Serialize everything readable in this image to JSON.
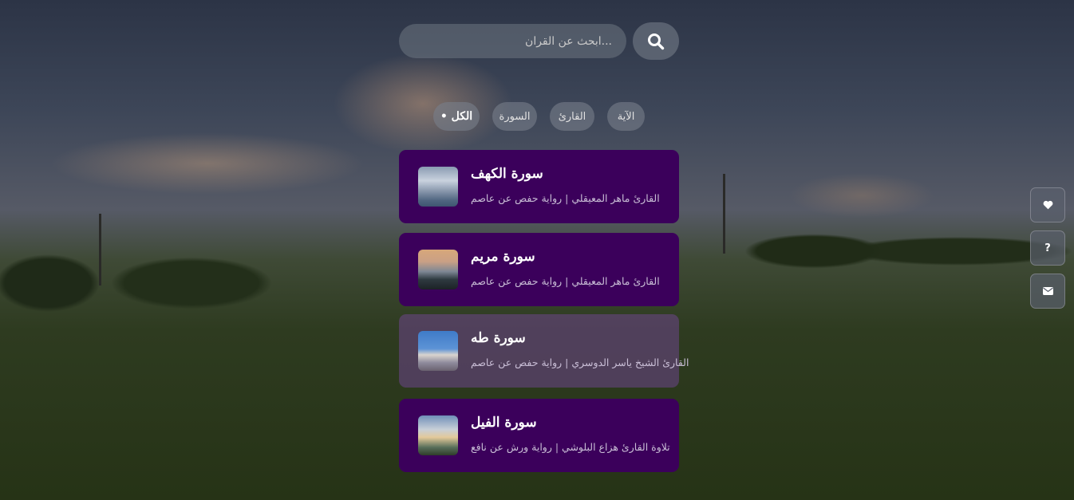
{
  "search": {
    "placeholder": "...ابحث عن القران"
  },
  "filters": [
    {
      "label": "الآية",
      "active": false
    },
    {
      "label": "القارئ",
      "active": false
    },
    {
      "label": "السورة",
      "active": false
    },
    {
      "label": "الكل •",
      "active": true
    }
  ],
  "results": [
    {
      "title": "سورة الكهف",
      "subtitle": "القارئ ماهر المعيقلي | رواية حفص عن عاصم",
      "thumbnail": "cloudy-sky"
    },
    {
      "title": "سورة مريم",
      "subtitle": "القارئ ماهر المعيقلي | رواية حفص عن عاصم",
      "thumbnail": "sea-rocks"
    },
    {
      "title": "سورة طه",
      "subtitle": "القارئ الشيخ ياسر الدوسري | رواية حفص عن عاصم",
      "thumbnail": "lighthouse-flowers"
    },
    {
      "title": "سورة الفيل",
      "subtitle": "تلاوة القارئ هزاع البلوشي | رواية ورش عن نافع",
      "thumbnail": "sunset-clouds"
    }
  ],
  "side_buttons": [
    {
      "icon": "heart-icon"
    },
    {
      "icon": "question-icon",
      "label": "?"
    },
    {
      "icon": "envelope-icon"
    }
  ],
  "colors": {
    "card": "#3b005b",
    "card_dim": "#6e468c",
    "subtitle": "#c9bed6"
  }
}
